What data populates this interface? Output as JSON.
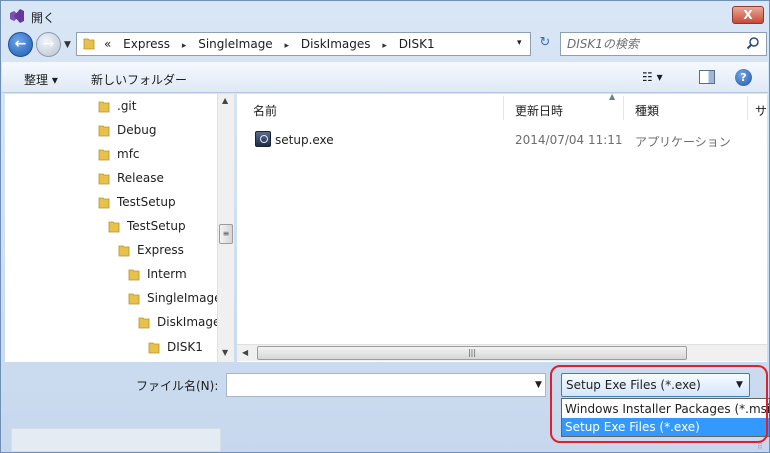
{
  "window": {
    "title": "開く",
    "close": "X"
  },
  "nav": {
    "back": "←",
    "breadcrumbs": [
      "«",
      "Express",
      "SingleImage",
      "DiskImages",
      "DISK1"
    ],
    "crumb_separator": "▸",
    "dropdown": "▾",
    "refresh": "↻"
  },
  "search": {
    "placeholder": "DISK1の検索"
  },
  "toolbar": {
    "organize": "整理 ▾",
    "new_folder": "新しいフォルダー",
    "view": "☷ ▾",
    "help": "?"
  },
  "tree": [
    {
      "label": ".git"
    },
    {
      "label": "Debug"
    },
    {
      "label": "mfc"
    },
    {
      "label": "Release"
    },
    {
      "label": "TestSetup"
    },
    {
      "label": "TestSetup"
    },
    {
      "label": "Express"
    },
    {
      "label": "Interm"
    },
    {
      "label": "SingleImage"
    },
    {
      "label": "DiskImage"
    },
    {
      "label": "DISK1"
    }
  ],
  "columns": {
    "name": "名前",
    "modified": "更新日時",
    "type": "種類",
    "size": "サ"
  },
  "files": [
    {
      "name": "setup.exe",
      "modified": "2014/07/04 11:11",
      "type": "アプリケーション"
    }
  ],
  "bottom": {
    "filename_label": "ファイル名(N):",
    "filename_value": "",
    "filter_selected": "Setup Exe Files (*.exe)",
    "filter_options": [
      "Windows Installer Packages (*.msi",
      "Setup Exe Files (*.exe)"
    ]
  },
  "colors": {
    "accent": "#3399ff",
    "highlight_ring": "#e0202a",
    "folder": "#e8c14a"
  }
}
